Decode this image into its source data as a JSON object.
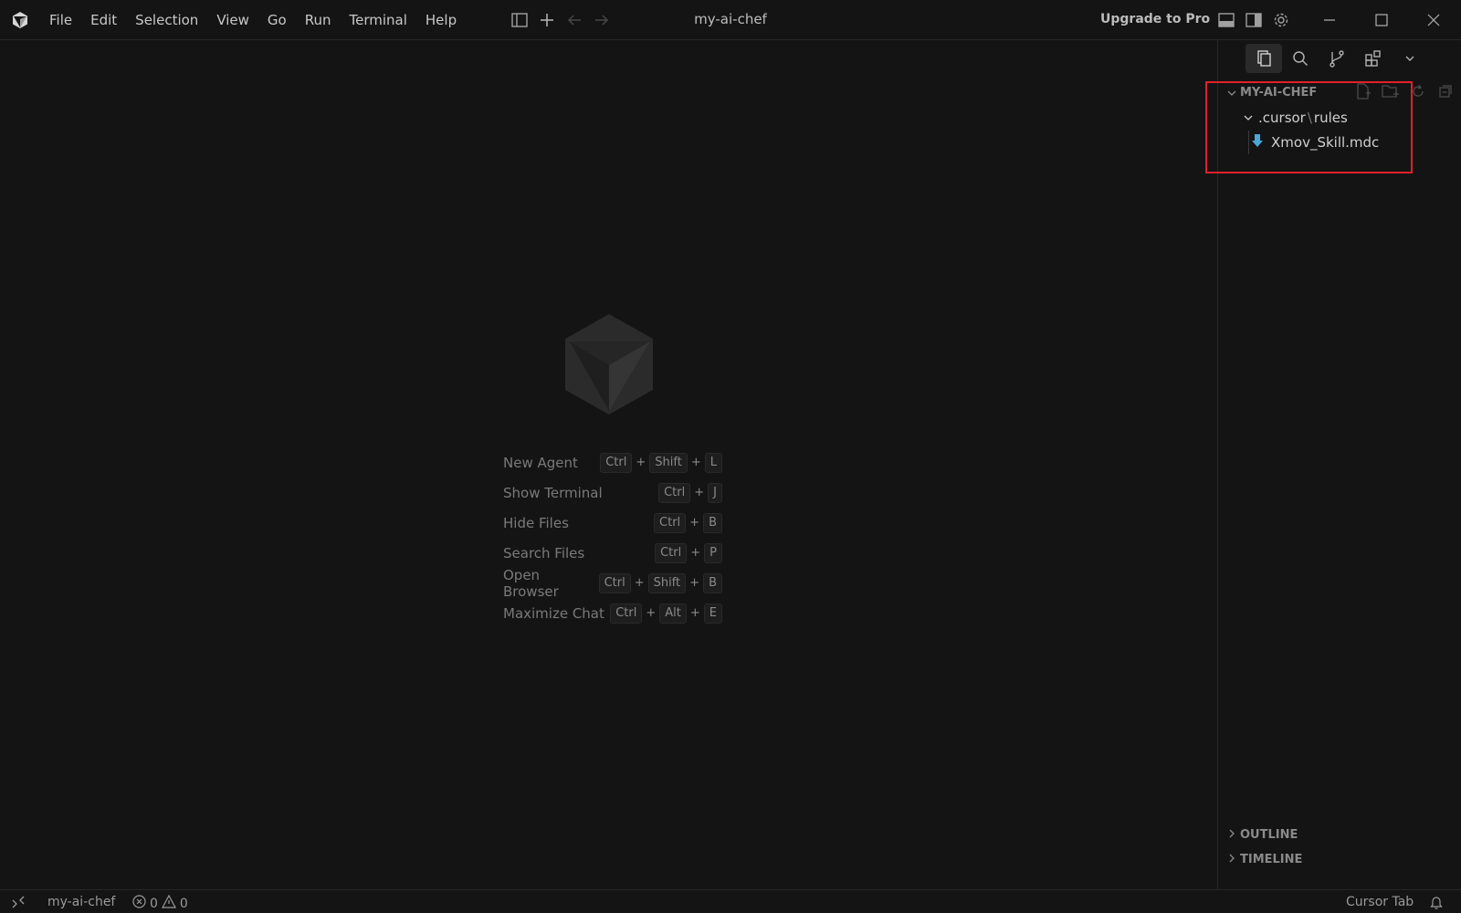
{
  "menu": [
    "File",
    "Edit",
    "Selection",
    "View",
    "Go",
    "Run",
    "Terminal",
    "Help"
  ],
  "window_title": "my-ai-chef",
  "upgrade_label": "Upgrade to Pro",
  "shortcuts": [
    {
      "label": "New Agent",
      "keys": [
        "Ctrl",
        "Shift",
        "L"
      ]
    },
    {
      "label": "Show Terminal",
      "keys": [
        "Ctrl",
        "J"
      ]
    },
    {
      "label": "Hide Files",
      "keys": [
        "Ctrl",
        "B"
      ]
    },
    {
      "label": "Search Files",
      "keys": [
        "Ctrl",
        "P"
      ]
    },
    {
      "label": "Open Browser",
      "keys": [
        "Ctrl",
        "Shift",
        "B"
      ]
    },
    {
      "label": "Maximize Chat",
      "keys": [
        "Ctrl",
        "Alt",
        "E"
      ]
    }
  ],
  "explorer": {
    "title": "MY-AI-CHEF",
    "folder_path": [
      ".cursor",
      "rules"
    ],
    "file_name": "Xmov_Skill.mdc",
    "outline_label": "OUTLINE",
    "timeline_label": "TIMELINE"
  },
  "status": {
    "project": "my-ai-chef",
    "errors": "0",
    "warnings": "0",
    "cursor_tab": "Cursor Tab"
  },
  "colors": {
    "highlight": "#e0202a",
    "file_icon": "#4aa8d8"
  }
}
